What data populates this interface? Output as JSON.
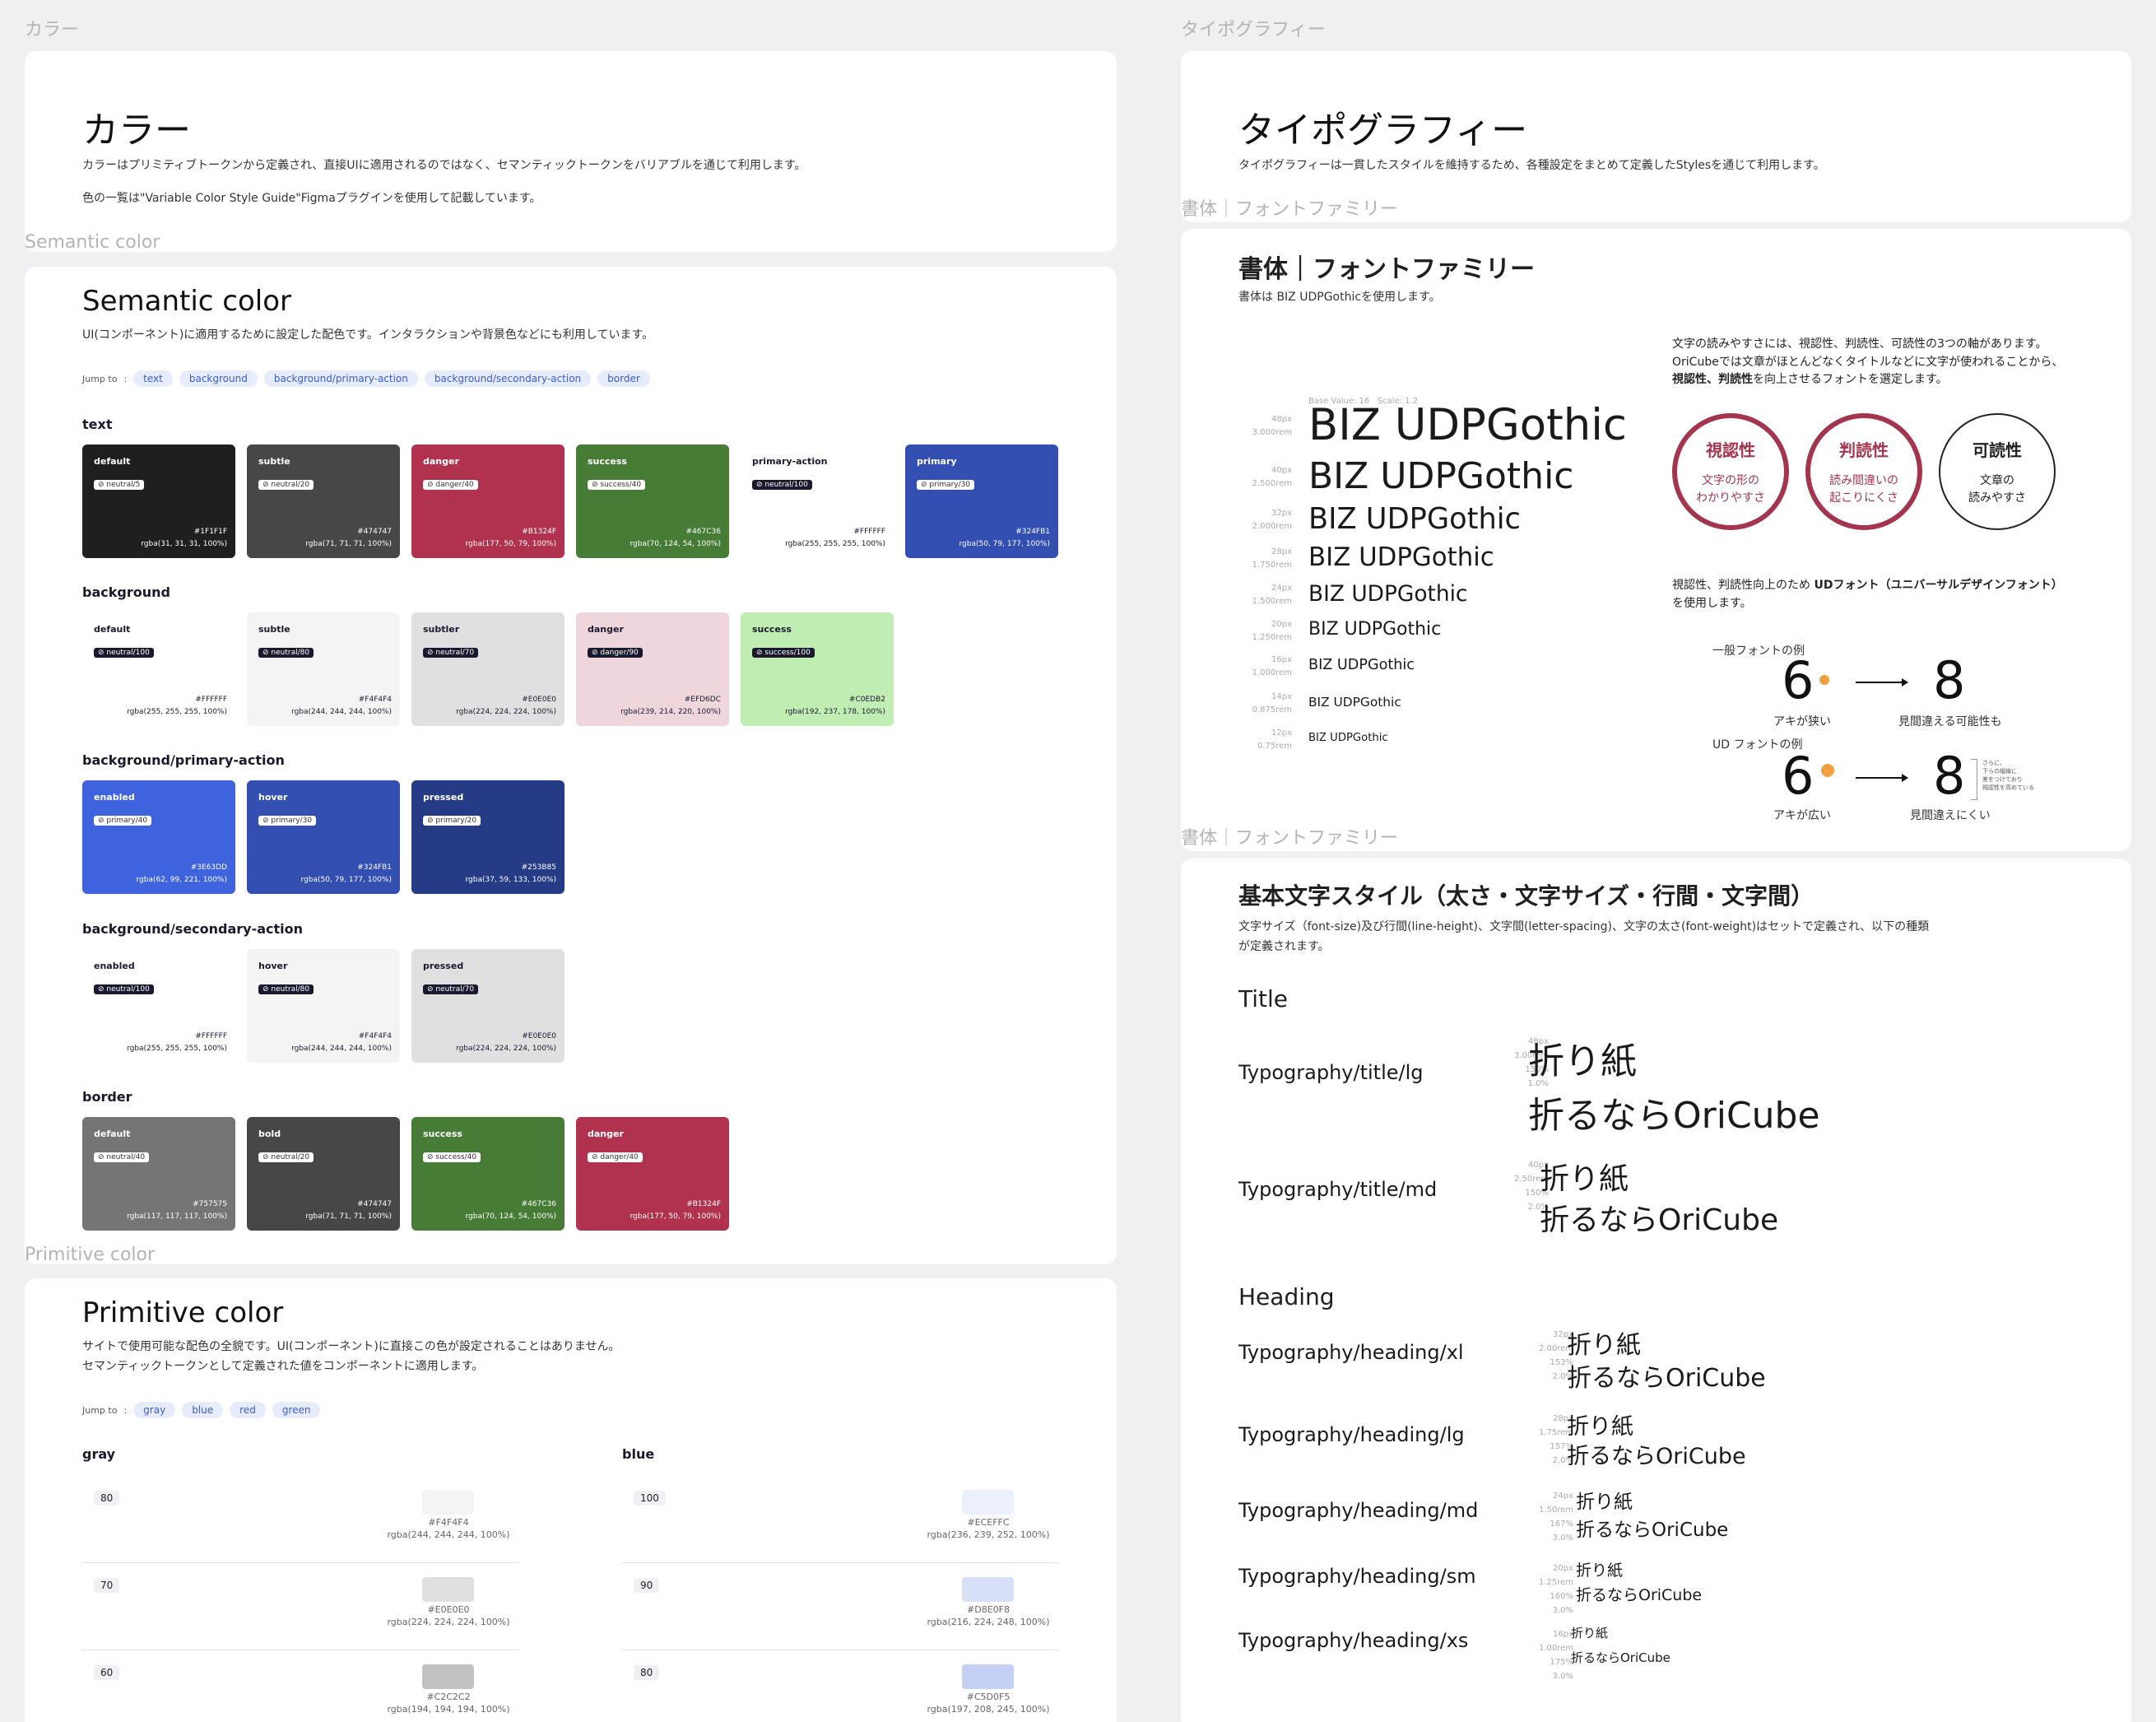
{
  "left": {
    "section_label": "カラー",
    "intro": {
      "title": "カラー",
      "p1": "カラーはプリミティブトークンから定義され、直接UIに適用されるのではなく、セマンティックトークンをバリアブルを通じて利用します。",
      "p2": "色の一覧は\"Variable Color Style Guide\"Figmaプラグインを使用して記載しています。"
    },
    "semantic": {
      "section_label": "Semantic color",
      "title": "Semantic color",
      "desc": "UI(コンポーネント)に適用するために設定した配色です。インタラクションや背景色などにも利用しています。",
      "jump_label": "Jump to",
      "jump_links": [
        "text",
        "background",
        "background/primary-action",
        "background/secondary-action",
        "border"
      ],
      "groups": [
        {
          "name": "text",
          "swatches": [
            {
              "name": "default",
              "token": "neutral/5",
              "hex": "#1F1F1F",
              "rgba": "rgba(31, 31, 31, 100%)",
              "color": "#1f1f1f",
              "theme": "dk"
            },
            {
              "name": "subtle",
              "token": "neutral/20",
              "hex": "#474747",
              "rgba": "rgba(71, 71, 71, 100%)",
              "color": "#474747",
              "theme": "dk"
            },
            {
              "name": "danger",
              "token": "danger/40",
              "hex": "#B1324F",
              "rgba": "rgba(177, 50, 79, 100%)",
              "color": "#b1324f",
              "theme": "dk"
            },
            {
              "name": "success",
              "token": "success/40",
              "hex": "#467C36",
              "rgba": "rgba(70, 124, 54, 100%)",
              "color": "#467c36",
              "theme": "dk"
            },
            {
              "name": "primary-action",
              "token": "neutral/100",
              "hex": "#FFFFFF",
              "rgba": "rgba(255, 255, 255, 100%)",
              "color": "#ffffff",
              "theme": "lt"
            },
            {
              "name": "primary",
              "token": "primary/30",
              "hex": "#324FB1",
              "rgba": "rgba(50, 79, 177, 100%)",
              "color": "#324fb1",
              "theme": "dk"
            }
          ]
        },
        {
          "name": "background",
          "swatches": [
            {
              "name": "default",
              "token": "neutral/100",
              "hex": "#FFFFFF",
              "rgba": "rgba(255, 255, 255, 100%)",
              "color": "#ffffff",
              "theme": "lt"
            },
            {
              "name": "subtle",
              "token": "neutral/80",
              "hex": "#F4F4F4",
              "rgba": "rgba(244, 244, 244, 100%)",
              "color": "#f4f4f4",
              "theme": "lt"
            },
            {
              "name": "subtler",
              "token": "neutral/70",
              "hex": "#E0E0E0",
              "rgba": "rgba(224, 224, 224, 100%)",
              "color": "#e0e0e0",
              "theme": "lt"
            },
            {
              "name": "danger",
              "token": "danger/90",
              "hex": "#EFD6DC",
              "rgba": "rgba(239, 214, 220, 100%)",
              "color": "#efd6dc",
              "theme": "lt"
            },
            {
              "name": "success",
              "token": "success/100",
              "hex": "#C0EDB2",
              "rgba": "rgba(192, 237, 178, 100%)",
              "color": "#c0edb2",
              "theme": "lt"
            }
          ]
        },
        {
          "name": "background/primary-action",
          "swatches": [
            {
              "name": "enabled",
              "token": "primary/40",
              "hex": "#3E63DD",
              "rgba": "rgba(62, 99, 221, 100%)",
              "color": "#3e63dd",
              "theme": "dk"
            },
            {
              "name": "hover",
              "token": "primary/30",
              "hex": "#324FB1",
              "rgba": "rgba(50, 79, 177, 100%)",
              "color": "#324fb1",
              "theme": "dk"
            },
            {
              "name": "pressed",
              "token": "primary/20",
              "hex": "#253B85",
              "rgba": "rgba(37, 59, 133, 100%)",
              "color": "#253b85",
              "theme": "dk"
            }
          ]
        },
        {
          "name": "background/secondary-action",
          "swatches": [
            {
              "name": "enabled",
              "token": "neutral/100",
              "hex": "#FFFFFF",
              "rgba": "rgba(255, 255, 255, 100%)",
              "color": "#ffffff",
              "theme": "lt"
            },
            {
              "name": "hover",
              "token": "neutral/80",
              "hex": "#F4F4F4",
              "rgba": "rgba(244, 244, 244, 100%)",
              "color": "#f4f4f4",
              "theme": "lt"
            },
            {
              "name": "pressed",
              "token": "neutral/70",
              "hex": "#E0E0E0",
              "rgba": "rgba(224, 224, 224, 100%)",
              "color": "#e0e0e0",
              "theme": "lt"
            }
          ]
        },
        {
          "name": "border",
          "swatches": [
            {
              "name": "default",
              "token": "neutral/40",
              "hex": "#757575",
              "rgba": "rgba(117, 117, 117, 100%)",
              "color": "#757575",
              "theme": "dk"
            },
            {
              "name": "bold",
              "token": "neutral/20",
              "hex": "#474747",
              "rgba": "rgba(71, 71, 71, 100%)",
              "color": "#474747",
              "theme": "dk"
            },
            {
              "name": "success",
              "token": "success/40",
              "hex": "#467C36",
              "rgba": "rgba(70, 124, 54, 100%)",
              "color": "#467c36",
              "theme": "dk"
            },
            {
              "name": "danger",
              "token": "danger/40",
              "hex": "#B1324F",
              "rgba": "rgba(177, 50, 79, 100%)",
              "color": "#b1324f",
              "theme": "dk"
            }
          ]
        }
      ]
    },
    "primitive": {
      "section_label": "Primitive color",
      "title": "Primitive color",
      "desc1": "サイトで使用可能な配色の全貌です。UI(コンポーネント)に直接この色が設定されることはありません。",
      "desc2": "セマンティックトークンとして定義された値をコンポーネントに適用します。",
      "jump_label": "Jump to",
      "jump_links": [
        "gray",
        "blue",
        "red",
        "green"
      ],
      "columns": [
        {
          "name": "gray",
          "rows": [
            {
              "level": "80",
              "hex": "#F4F4F4",
              "rgba": "rgba(244, 244, 244, 100%)",
              "color": "#f4f4f4"
            },
            {
              "level": "70",
              "hex": "#E0E0E0",
              "rgba": "rgba(224, 224, 224, 100%)",
              "color": "#e0e0e0"
            },
            {
              "level": "60",
              "hex": "#C2C2C2",
              "rgba": "rgba(194, 194, 194, 100%)",
              "color": "#c2c2c2"
            }
          ]
        },
        {
          "name": "blue",
          "rows": [
            {
              "level": "100",
              "hex": "#ECEFFC",
              "rgba": "rgba(236, 239, 252, 100%)",
              "color": "#eceffc"
            },
            {
              "level": "90",
              "hex": "#D8E0F8",
              "rgba": "rgba(216, 224, 248, 100%)",
              "color": "#d8e0f8"
            },
            {
              "level": "80",
              "hex": "#C5D0F5",
              "rgba": "rgba(197, 208, 245, 100%)",
              "color": "#c5d0f5"
            }
          ]
        }
      ]
    }
  },
  "right": {
    "section_label": "タイポグラフィー",
    "intro": {
      "title": "タイポグラフィー",
      "p1": "タイポグラフィーは一貫したスタイルを維持するため、各種設定をまとめて定義したStylesを通じて利用します。"
    },
    "fontfamily": {
      "section_label": "書体｜フォントファミリー",
      "title": "書体｜フォントファミリー",
      "desc": "書体は BIZ UDPGothicを使用します。",
      "base_value": "Base Value: 16",
      "scale": "Scale: 1.2",
      "samples": [
        {
          "px": "48px",
          "rem": "3.000rem",
          "text": "BIZ UDPGothic",
          "size": 48
        },
        {
          "px": "40px",
          "rem": "2.500rem",
          "text": "BIZ UDPGothic",
          "size": 40
        },
        {
          "px": "32px",
          "rem": "2.000rem",
          "text": "BIZ UDPGothic",
          "size": 32
        },
        {
          "px": "28px",
          "rem": "1.750rem",
          "text": "BIZ UDPGothic",
          "size": 28
        },
        {
          "px": "24px",
          "rem": "1.500rem",
          "text": "BIZ UDPGothic",
          "size": 24
        },
        {
          "px": "20px",
          "rem": "1.250rem",
          "text": "BIZ UDPGothic",
          "size": 20
        },
        {
          "px": "16px",
          "rem": "1.000rem",
          "text": "BIZ UDPGothic",
          "size": 16
        },
        {
          "px": "14px",
          "rem": "0.875rem",
          "text": "BIZ UDPGothic",
          "size": 14
        },
        {
          "px": "12px",
          "rem": "0.75rem",
          "text": "BIZ UDPGothic",
          "size": 12
        }
      ],
      "explain1": "文字の読みやすさには、視認性、判読性、可読性の3つの軸があります。",
      "explain2": "OriCubeでは文章がほとんどなくタイトルなどに文字が使われることから、",
      "explain3a": "視認性、判読性",
      "explain3b": "を向上させるフォントを選定します。",
      "circles": [
        {
          "title": "視認性",
          "sub1": "文字の形の",
          "sub2": "わかりやすさ",
          "color": "#a3354f"
        },
        {
          "title": "判読性",
          "sub1": "読み間違いの",
          "sub2": "起こりにくさ",
          "color": "#a3354f"
        },
        {
          "title": "可読性",
          "sub1": "文章の",
          "sub2": "読みやすさ",
          "color": "#222222"
        }
      ],
      "ud1": "視認性、判読性向上のため ",
      "ud_bold": "UDフォント（ユニバーサルデザインフォント）",
      "ud2": "を使用します。",
      "general_label": "一般フォントの例",
      "general_left": "アキが狭い",
      "general_right": "見間違える可能性も",
      "ud_label": "UD フォントの例",
      "ud_left": "アキが広い",
      "ud_right": "見間違えにくい",
      "digit6": "6",
      "digit8": "8",
      "note1": "さらに、",
      "note2": "下らの縦線に",
      "note3": "差をつけており",
      "note4": "視認性を高めている"
    },
    "textstyles": {
      "section_label": "書体｜フォントファミリー",
      "title": "基本文字スタイル（太さ・文字サイズ・行間・文字間）",
      "desc1": "文字サイズ（font-size)及び行間(line-height)、文字間(letter-spacing)、文字の太さ(font-weight)はセットで定義され、以下の種類",
      "desc2": "が定義されます。",
      "title_group": "Title",
      "heading_group": "Heading",
      "styles": [
        {
          "name": "Typography/title/lg",
          "px": "48px",
          "rem": "3.00rem",
          "lh": "150%",
          "ls": "1.0%",
          "l1": "折り紙",
          "l2": "折るならOriCube",
          "size": 44
        },
        {
          "name": "Typography/title/md",
          "px": "40px",
          "rem": "2.50rem",
          "lh": "150%",
          "ls": "2.0%",
          "l1": "折り紙",
          "l2": "折るならOriCube",
          "size": 36
        },
        {
          "name": "Typography/heading/xl",
          "px": "32px",
          "rem": "2.00rem",
          "lh": "153%",
          "ls": "2.0%",
          "l1": "折り紙",
          "l2": "折るならOriCube",
          "size": 30
        },
        {
          "name": "Typography/heading/lg",
          "px": "28px",
          "rem": "1.75rem",
          "lh": "157%",
          "ls": "2.0%",
          "l1": "折り紙",
          "l2": "折るならOriCube",
          "size": 27
        },
        {
          "name": "Typography/heading/md",
          "px": "24px",
          "rem": "1.50rem",
          "lh": "167%",
          "ls": "3.0%",
          "l1": "折り紙",
          "l2": "折るならOriCube",
          "size": 23
        },
        {
          "name": "Typography/heading/sm",
          "px": "20px",
          "rem": "1.25rem",
          "lh": "160%",
          "ls": "3.0%",
          "l1": "折り紙",
          "l2": "折るならOriCube",
          "size": 19
        },
        {
          "name": "Typography/heading/xs",
          "px": "16px",
          "rem": "1.00rem",
          "lh": "175%",
          "ls": "3.0%",
          "l1": "折り紙",
          "l2": "折るならOriCube",
          "size": 15
        }
      ]
    }
  }
}
